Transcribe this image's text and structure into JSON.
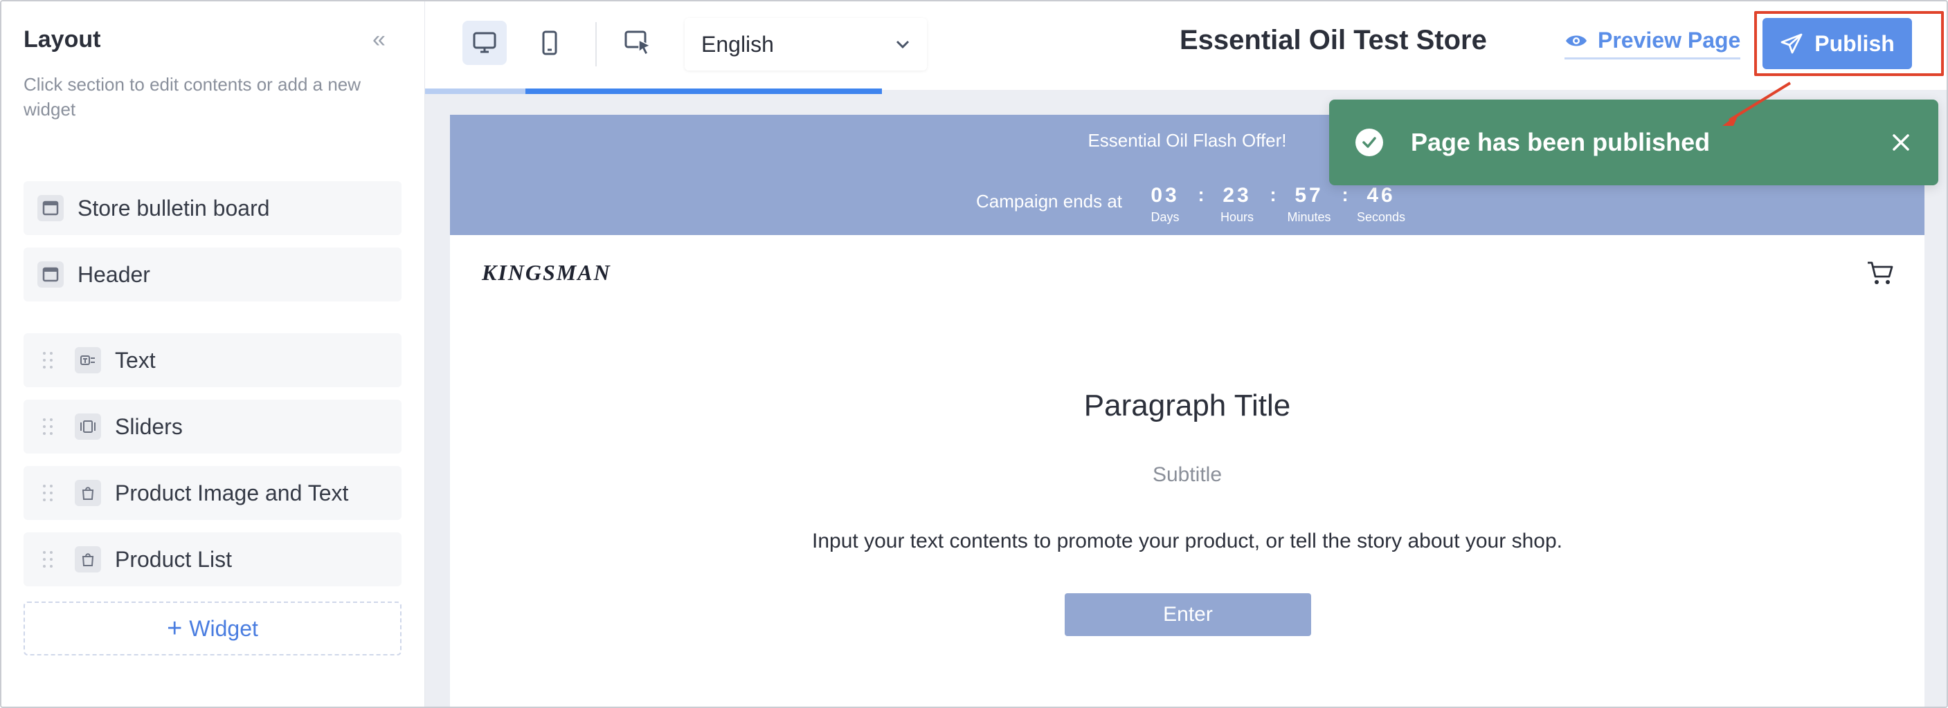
{
  "sidebar": {
    "title": "Layout",
    "collapse_glyph": "«",
    "description": "Click section to edit contents or add a new widget",
    "fixed_sections": [
      {
        "label": "Store bulletin board",
        "icon": "window-icon"
      },
      {
        "label": "Header",
        "icon": "window-icon"
      }
    ],
    "sections": [
      {
        "label": "Text",
        "icon": "text-block-icon"
      },
      {
        "label": "Sliders",
        "icon": "slider-icon"
      },
      {
        "label": "Product Image and Text",
        "icon": "shopping-bag-icon"
      },
      {
        "label": "Product List",
        "icon": "shopping-bag-icon"
      }
    ],
    "add_widget_label": "Widget"
  },
  "toolbar": {
    "devices": [
      "desktop-icon",
      "mobile-icon"
    ],
    "active_device": "desktop",
    "language": "English",
    "store_name": "Essential Oil Test Store",
    "preview_label": "Preview Page",
    "publish_label": "Publish"
  },
  "editor": {
    "load_progress_percent": 30
  },
  "preview_page": {
    "bulletin": {
      "title": "Essential Oil Flash Offer!",
      "campaign_label": "Campaign ends at",
      "countdown": [
        {
          "value": "03",
          "unit": "Days"
        },
        {
          "value": "23",
          "unit": "Hours"
        },
        {
          "value": "57",
          "unit": "Minutes"
        },
        {
          "value": "46",
          "unit": "Seconds"
        }
      ]
    },
    "header": {
      "logo": "KINGSMAN"
    },
    "text_section": {
      "title": "Paragraph Title",
      "subtitle": "Subtitle",
      "body": "Input your text contents to promote your product, or tell the story about your shop.",
      "button_label": "Enter"
    }
  },
  "toast": {
    "message": "Page has been published",
    "type": "success"
  },
  "colors": {
    "accent": "#5b8fe8",
    "bulletin_bg": "#93a7d2",
    "toast_bg": "#4f9070",
    "highlight": "#e0432b"
  }
}
